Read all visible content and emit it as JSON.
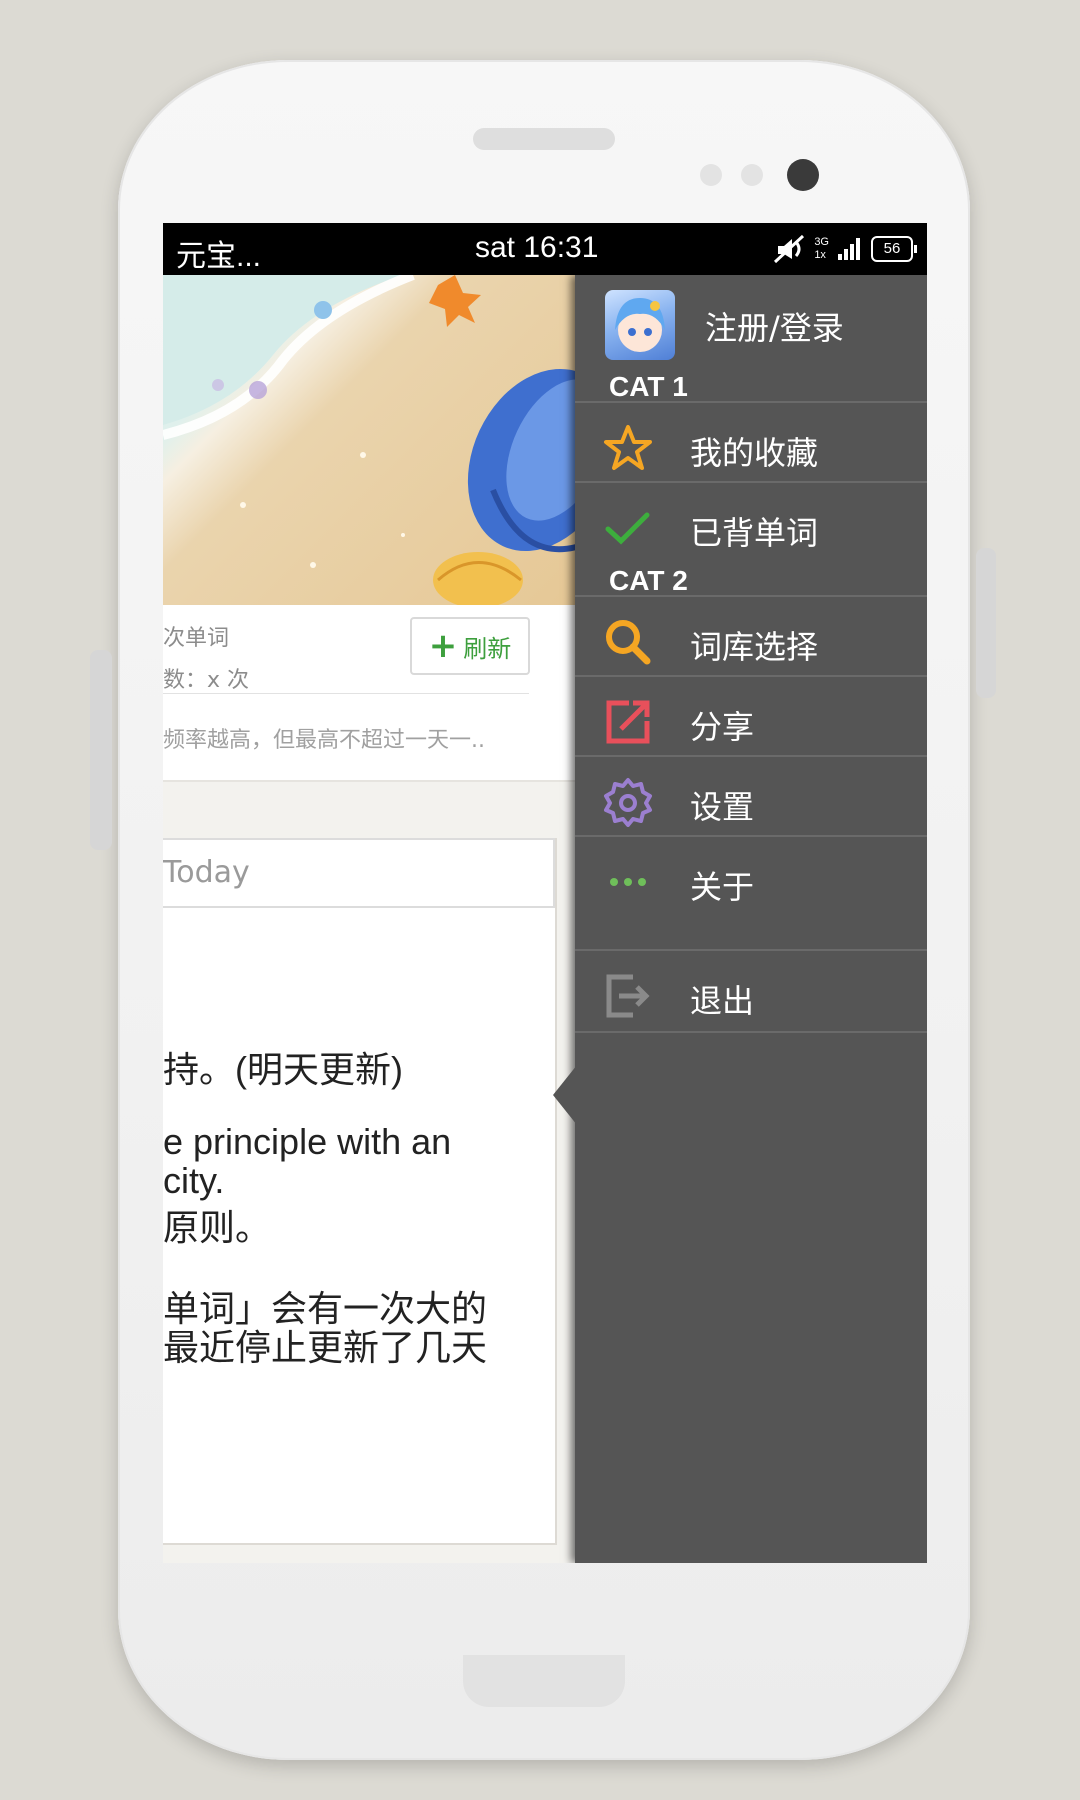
{
  "status_bar": {
    "carrier": "元宝...",
    "time": "sat 16:31",
    "network": [
      "3G",
      "1x"
    ],
    "battery": "56"
  },
  "content": {
    "card": {
      "line1": "次单词",
      "line2": "数：x 次",
      "refresh_label": "刷新",
      "line3": "频率越高，但最高不超过一天一.."
    },
    "today_input_value": "Today",
    "text_lines": [
      "持。(明天更新)",
      "e principle with an",
      "city.",
      "原则。",
      "单词」会有一次大的",
      "最近停止更新了几天"
    ]
  },
  "drawer": {
    "login_label": "注册/登录",
    "cat1": "CAT 1",
    "cat2": "CAT 2",
    "items": [
      {
        "label": "我的收藏",
        "icon": "star-icon",
        "color": "#f5a623"
      },
      {
        "label": "已背单词",
        "icon": "checkmark-icon",
        "color": "#3dae3d"
      },
      {
        "label": "词库选择",
        "icon": "search-icon",
        "color": "#f5a623"
      },
      {
        "label": "分享",
        "icon": "share-icon",
        "color": "#e8505b"
      },
      {
        "label": "设置",
        "icon": "gear-icon",
        "color": "#9b7fd0"
      },
      {
        "label": "关于",
        "icon": "more-dots-icon",
        "color": "#6fbf5a"
      },
      {
        "label": "退出",
        "icon": "logout-icon",
        "color": "#8a8a8a"
      }
    ]
  }
}
